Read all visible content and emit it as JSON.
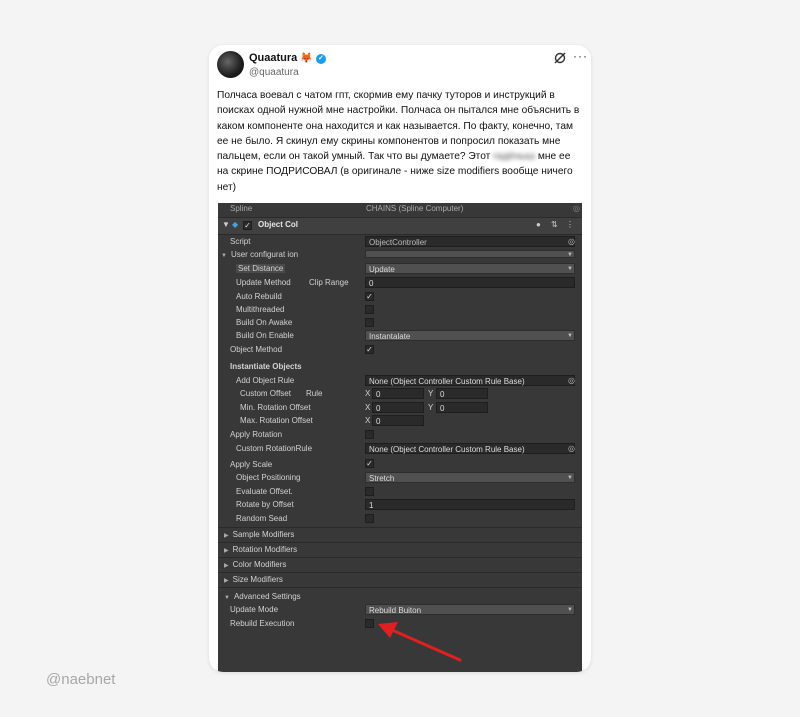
{
  "tweet": {
    "author_name": "Quaatura",
    "author_emoji": "🦊",
    "handle": "@quaatura",
    "text_before_blur": "Полчаса воевал с чатом гпт, скормив ему пачку туторов и инструкций в поисках одной нужной мне настройки. Полчаса он пытался мне объяснить в каком компоненте она находится и как называется. По факту, конечно, там ее не было. Я скинул ему скрины компонентов и попросил показать мне пальцем, если  он такой умный. Так что вы думаете? Этот ",
    "blurred_word": "гадёныш",
    "text_after_blur": " мне ее на скрине ПОДРИСОВАЛ (в оригинале - ниже size modifiers вообще ничего нет)"
  },
  "editor": {
    "spline_label": "Spline",
    "spline_value": "CHAINS (Spline Computer)",
    "component_title": "Object Col",
    "script_label": "Script",
    "script_value": "ObjectController",
    "user_config_label": "User configurat ion",
    "set_distance_label": "Set Distance",
    "set_distance_value": "Update",
    "update_method_label": "Update Method",
    "clip_range_label": "Clip Range",
    "update_method_value": "0",
    "auto_rebuild_label": "Auto Rebuild",
    "multithreaded_label": "Multithreaded",
    "build_on_awake_label": "Build On Awake",
    "build_on_enable_label": "Build On Enable",
    "build_on_enable_value": "Instantalate",
    "object_method_label": "Object Method",
    "instantiate_header": "Instantiate Objects",
    "add_object_rule_label": "Add Object Rule",
    "add_object_rule_value": "None (Object Controller Custom Rule Base)",
    "custom_offset_label": "Custom Offset",
    "rule_label": "Rule",
    "min_rotation_label": "Min. Rotation Offset",
    "max_rotation_label": "Max. Rotation Offset",
    "axis_x": "X",
    "axis_y": "Y",
    "zero": "0",
    "apply_rotation_label": "Apply Rotation",
    "custom_rotation_label": "Custom RotationRule",
    "custom_rotation_value": "None (Object Controller Custom Rule Base)",
    "apply_scale_label": "Apply Scale",
    "object_positioning_label": "Object Positioning",
    "object_positioning_value": "Stretch",
    "evaluate_offset_label": "Evaluate Offset.",
    "rotate_by_offset_label": "Rotate by Offset",
    "rotate_by_offset_value": "1",
    "random_seed_label": "Random Sead",
    "sample_modifiers": "Sample Modifiers",
    "rotation_modifiers": "Rotation Modifiers",
    "color_modifiers": "Color Modifiers",
    "size_modifiers": "Size Modifiers",
    "advanced_settings": "Advanced Settings",
    "update_mode_label": "Update Mode",
    "update_mode_value": "Rebuild Buiton",
    "rebuild_execution_label": "Rebuild Execution",
    "checkmark": "✓"
  },
  "watermark": "@naebnet",
  "colors": {
    "verified_blue": "#1d9bf0",
    "annotation_red": "#e02020",
    "editor_bg": "#383838"
  }
}
